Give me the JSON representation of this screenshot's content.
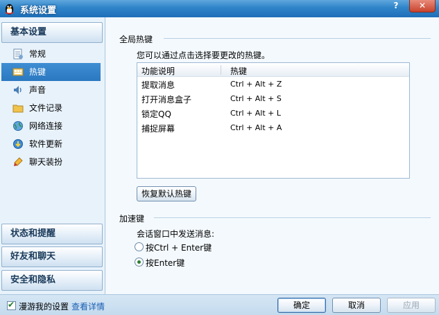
{
  "window": {
    "title": "系统设置",
    "help_label": "?",
    "close_label": "✕"
  },
  "sidebar": {
    "section_basic": "基本设置",
    "items": [
      {
        "label": "常规",
        "icon": "document-icon"
      },
      {
        "label": "热键",
        "icon": "keyboard-icon"
      },
      {
        "label": "声音",
        "icon": "speaker-icon"
      },
      {
        "label": "文件记录",
        "icon": "folder-icon"
      },
      {
        "label": "网络连接",
        "icon": "network-icon"
      },
      {
        "label": "软件更新",
        "icon": "update-icon"
      },
      {
        "label": "聊天装扮",
        "icon": "brush-icon"
      }
    ],
    "active_index": 1,
    "section_status": "状态和提醒",
    "section_friends": "好友和聊天",
    "section_security": "安全和隐私"
  },
  "global_hotkeys": {
    "title": "全局热键",
    "hint": "您可以通过点击选择要更改的热键。",
    "columns": [
      "功能说明",
      "热键"
    ],
    "rows": [
      {
        "function": "提取消息",
        "hotkey": "Ctrl + Alt + Z"
      },
      {
        "function": "打开消息盒子",
        "hotkey": "Ctrl + Alt + S"
      },
      {
        "function": "锁定QQ",
        "hotkey": "Ctrl + Alt + L"
      },
      {
        "function": "捕捉屏幕",
        "hotkey": "Ctrl + Alt + A"
      }
    ],
    "restore_label": "恢复默认热键"
  },
  "accelerator": {
    "title": "加速键",
    "send_prompt": "会话窗口中发送消息:",
    "options": [
      {
        "label": "按Ctrl + Enter键",
        "checked": false
      },
      {
        "label": "按Enter键",
        "checked": true
      }
    ]
  },
  "footer": {
    "roam_label": "漫游我的设置",
    "roam_checked": true,
    "detail_link": "查看详情",
    "ok_label": "确定",
    "cancel_label": "取消",
    "apply_label": "应用"
  },
  "colors": {
    "titlebar": "#2f84c9",
    "active_nav": "#3f8ed3",
    "link": "#1a5fb4"
  }
}
